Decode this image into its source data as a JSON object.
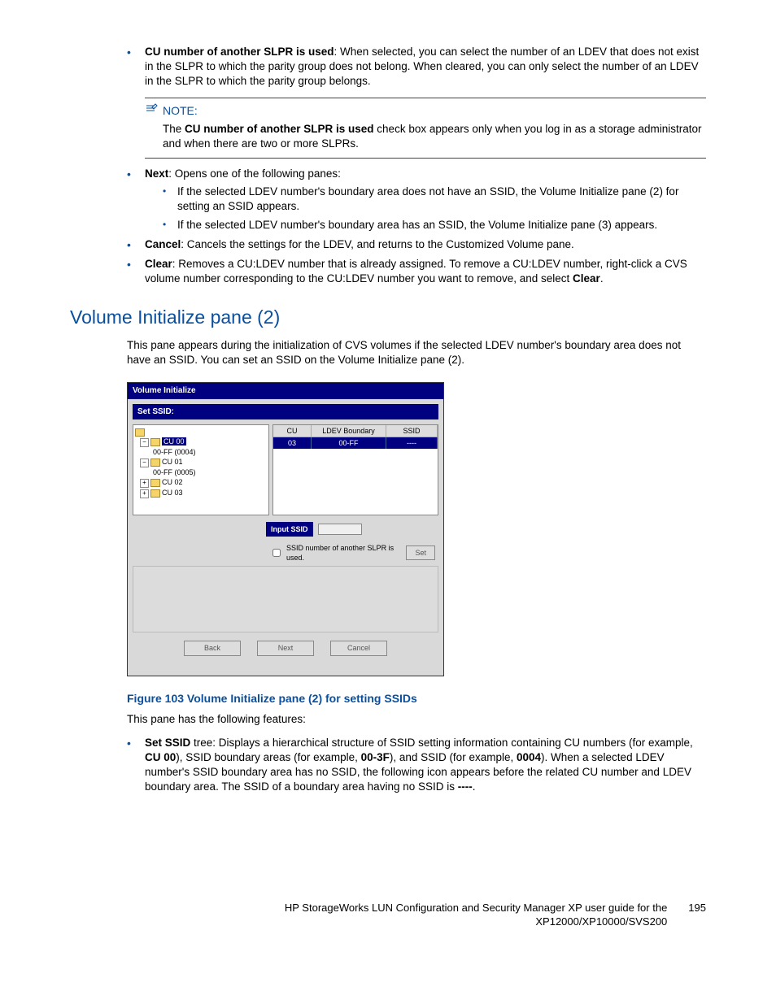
{
  "top_bullets": {
    "cu_number_bold": "CU number of another SLPR is used",
    "cu_number_rest": ": When selected, you can select the number of an LDEV that does not exist in the SLPR to which the parity group does not belong. When cleared, you can only select the number of an LDEV in the SLPR to which the parity group belongs."
  },
  "note": {
    "label": "NOTE:",
    "body_pre": "The ",
    "body_bold": "CU number of another SLPR is used",
    "body_post": " check box appears only when you log in as a storage administrator and when there are two or more SLPRs."
  },
  "mid_bullets": {
    "next_bold": "Next",
    "next_rest": ": Opens one of the following panes:",
    "next_sub1": "If the selected LDEV number's boundary area does not have an SSID, the Volume Initialize pane (2) for setting an SSID appears.",
    "next_sub2": "If the selected LDEV number's boundary area has an SSID, the Volume Initialize pane (3) appears.",
    "cancel_bold": "Cancel",
    "cancel_rest": ": Cancels the settings for the LDEV, and returns to the Customized Volume pane.",
    "clear_bold": "Clear",
    "clear_rest1": ": Removes a CU:LDEV number that is already assigned. To remove a CU:LDEV number, right-click a CVS volume number corresponding to the CU:LDEV number you want to remove, and select ",
    "clear_rest_bold": "Clear",
    "clear_rest2": "."
  },
  "section_heading": "Volume Initialize pane (2)",
  "section_intro": "This pane appears during the initialization of CVS volumes if the selected LDEV number's boundary area does not have an SSID. You can set an SSID on the Volume Initialize pane (2).",
  "dialog": {
    "title": "Volume Initialize",
    "set_ssid_label": "Set SSID:",
    "tree": {
      "cu00": "CU 00",
      "cu00_sub": "00-FF (0004)",
      "cu01": "CU 01",
      "cu01_sub": "00-FF (0005)",
      "cu02": "CU 02",
      "cu03": "CU 03"
    },
    "grid": {
      "h_cu": "CU",
      "h_boundary": "LDEV Boundary",
      "h_ssid": "SSID",
      "r_cu": "03",
      "r_boundary": "00-FF",
      "r_ssid": "----"
    },
    "input_ssid_label": "Input SSID",
    "chk_label": "SSID number of another SLPR is used.",
    "btn_set": "Set",
    "btn_back": "Back",
    "btn_next": "Next",
    "btn_cancel": "Cancel"
  },
  "figure_caption": "Figure 103 Volume Initialize pane (2) for setting SSIDs",
  "features_intro": "This pane has the following features:",
  "feature1": {
    "bold1": "Set SSID",
    "t1": " tree: Displays a hierarchical structure of SSID setting information containing CU numbers (for example, ",
    "bold2": "CU 00",
    "t2": "), SSID boundary areas (for example, ",
    "bold3": "00-3F",
    "t3": "), and SSID (for example, ",
    "bold4": "0004",
    "t4": "). When a selected LDEV number's SSID boundary area has no SSID, the following icon appears before the related CU number and LDEV boundary area. The SSID of a boundary area having no SSID is ",
    "bold5": "----",
    "t5": "."
  },
  "footer": {
    "text1": "HP StorageWorks LUN Configuration and Security Manager XP user guide for the",
    "text2": "XP12000/XP10000/SVS200",
    "page": "195"
  }
}
